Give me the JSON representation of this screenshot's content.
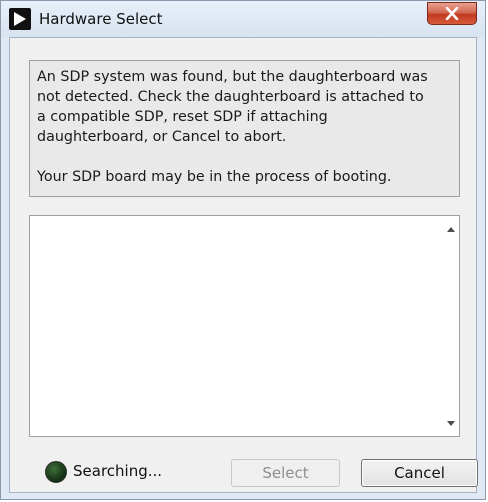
{
  "window": {
    "title": "Hardware Select"
  },
  "message": {
    "line1": "An SDP system was found, but the daughterboard was\nnot detected. Check the daughterboard is attached to\na compatible SDP, reset SDP if attaching\ndaughterboard, or Cancel to abort.",
    "line2": "Your SDP board may be in the process of booting."
  },
  "list": {
    "items": []
  },
  "status": {
    "text": "Searching...",
    "led_color": "#1b3a1a"
  },
  "buttons": {
    "select_label": "Select",
    "select_enabled": false,
    "cancel_label": "Cancel"
  }
}
